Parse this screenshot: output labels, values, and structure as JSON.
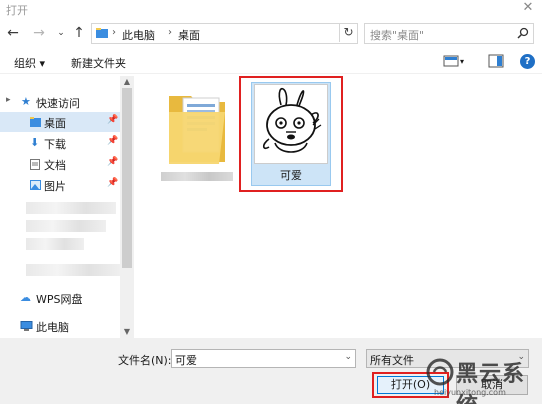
{
  "window": {
    "title": "打开"
  },
  "nav": {
    "breadcrumb": [
      "此电脑",
      "桌面"
    ],
    "search_placeholder": "搜索\"桌面\""
  },
  "toolbar": {
    "organize": "组织 ▾",
    "new_folder": "新建文件夹",
    "help": "?"
  },
  "sidebar": {
    "quick_access": "快速访问",
    "items": [
      {
        "label": "桌面",
        "pinned": true,
        "selected": true
      },
      {
        "label": "下载",
        "pinned": true
      },
      {
        "label": "文档",
        "pinned": true
      },
      {
        "label": "图片",
        "pinned": true
      }
    ],
    "wps": "WPS网盘",
    "this_pc": "此电脑"
  },
  "files": [
    {
      "name": "",
      "type": "folder",
      "name_obscured": true
    },
    {
      "name": "可爱",
      "type": "image",
      "selected": true
    }
  ],
  "bottom": {
    "filename_label": "文件名(N):",
    "filename_value": "可爱",
    "filetype_value": "所有文件",
    "open_label": "打开(O)",
    "cancel_label": "取消"
  },
  "watermark": {
    "text": "黑云系统",
    "url": "heiyunxitong.com"
  },
  "colors": {
    "accent": "#0078d7",
    "highlight_red": "#e02020",
    "selection": "#cde4f7"
  }
}
